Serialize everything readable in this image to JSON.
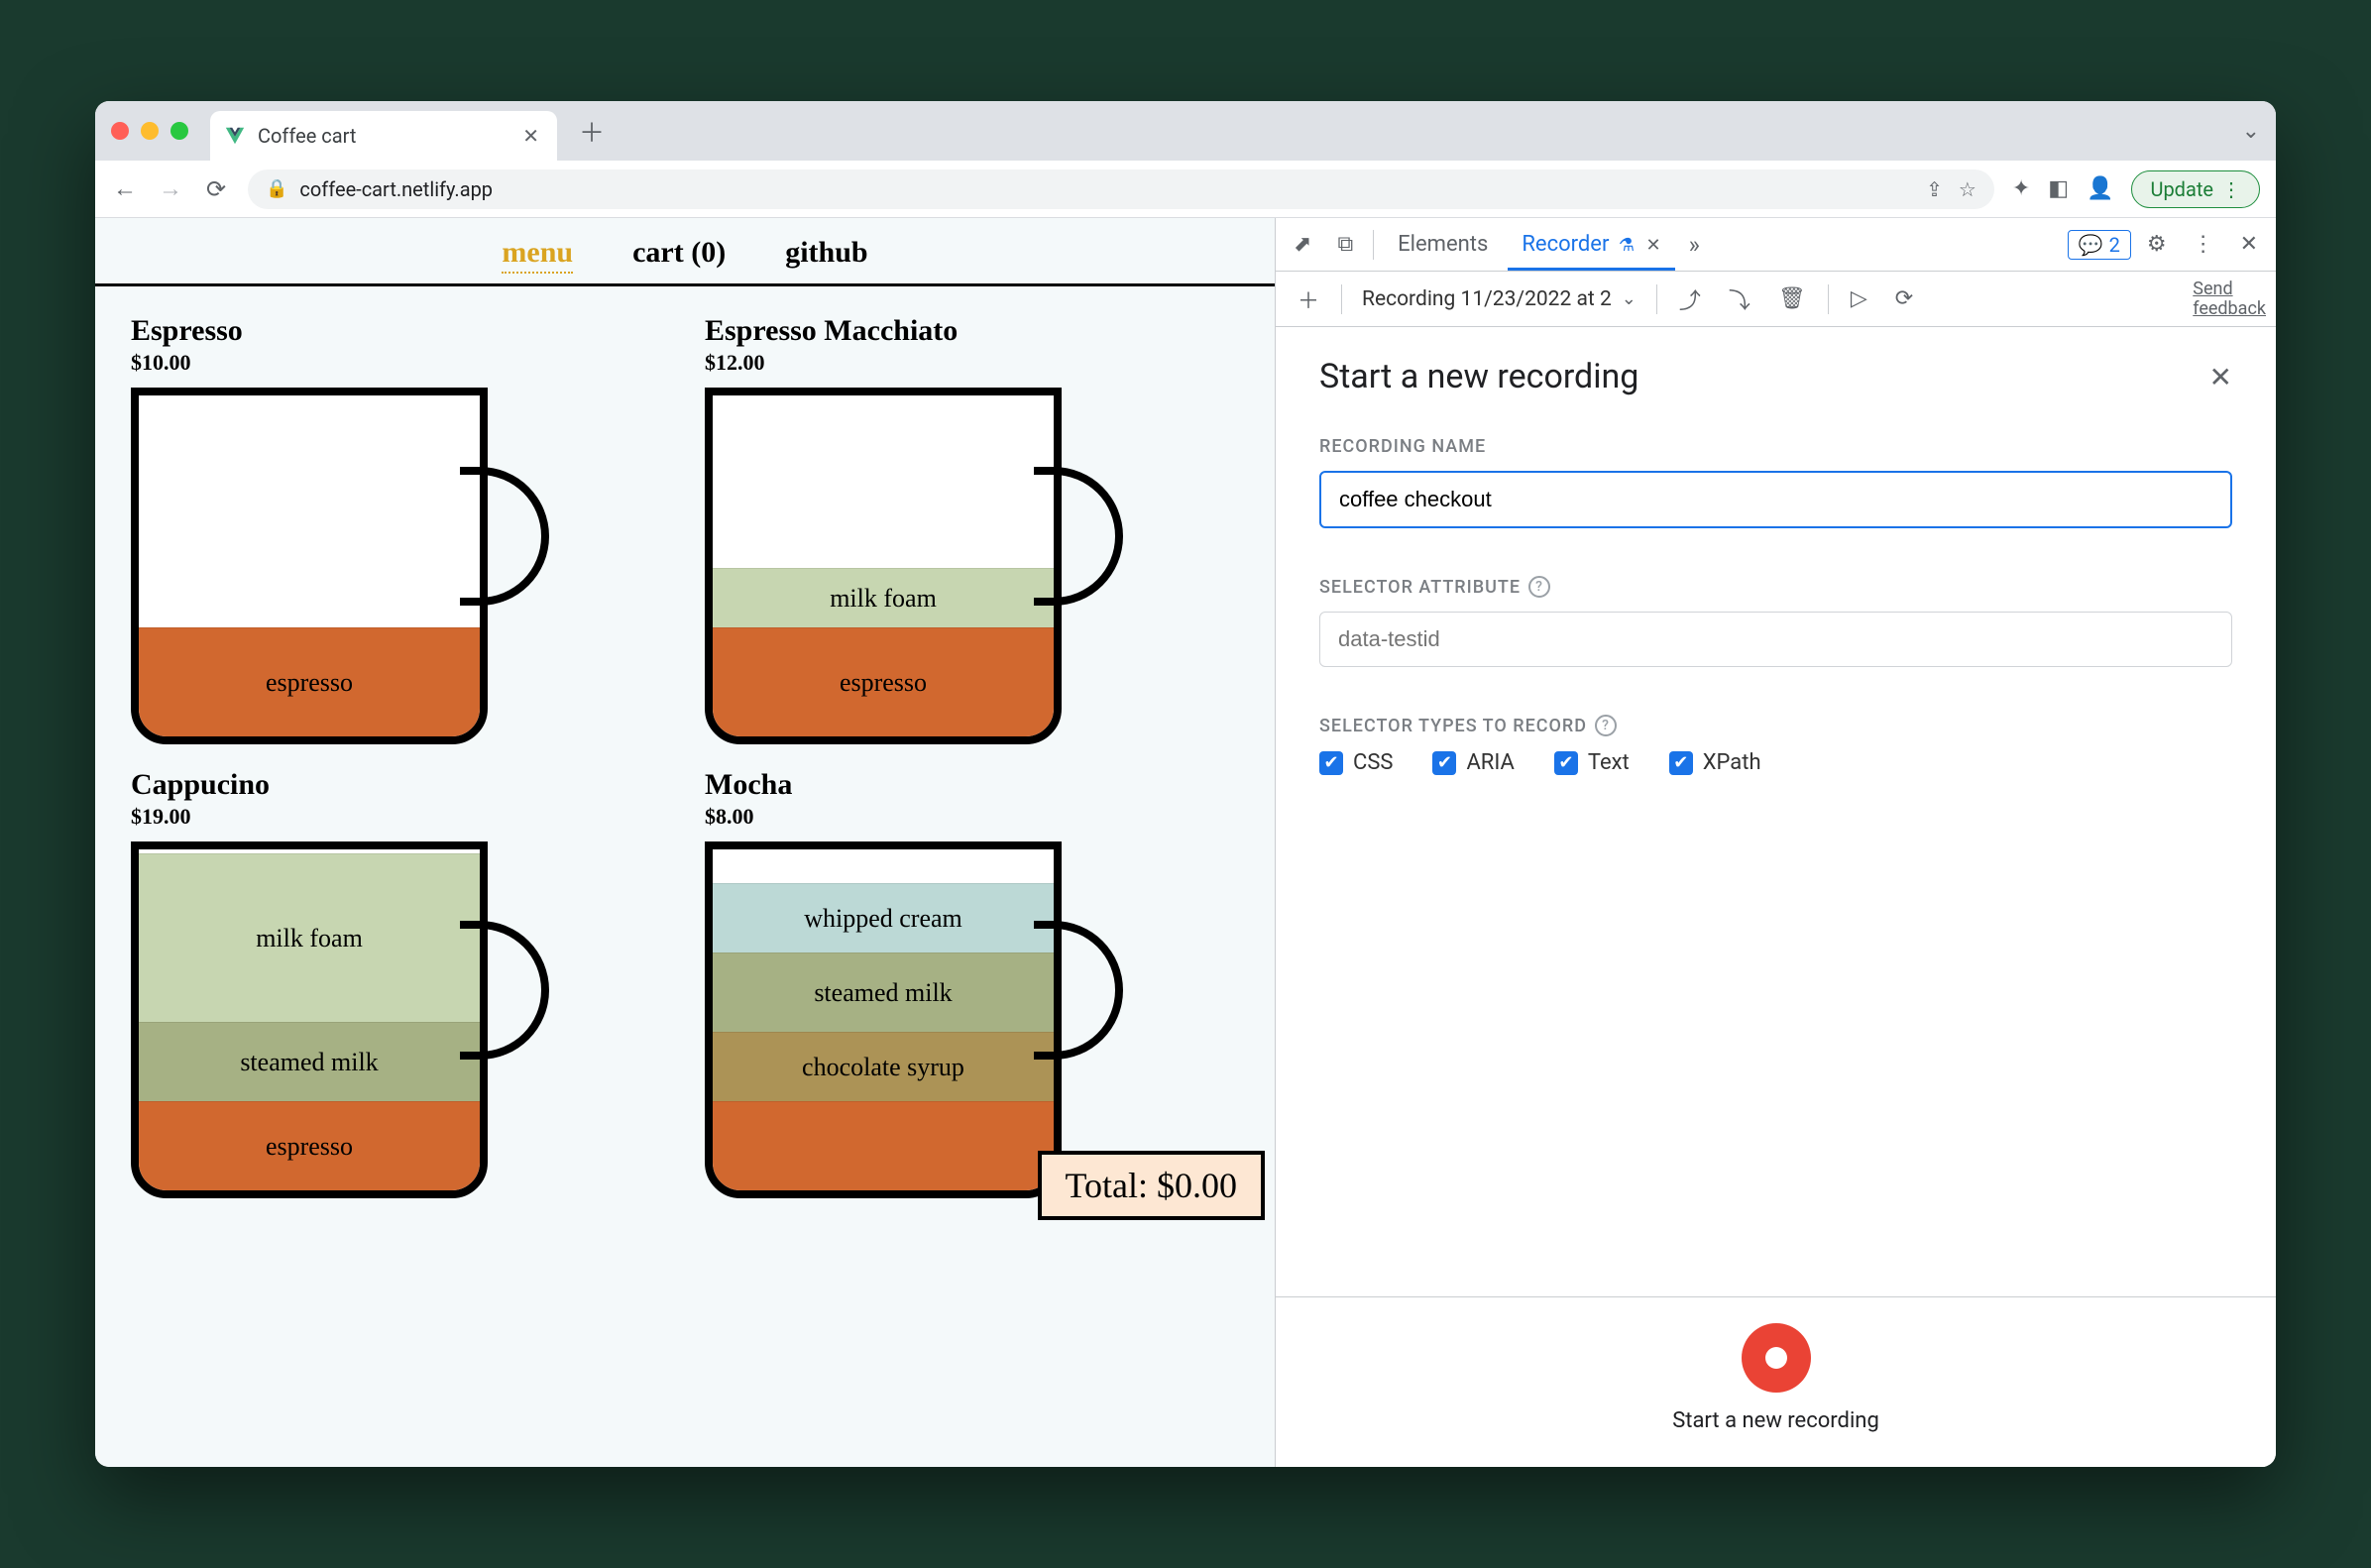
{
  "browser": {
    "tab_title": "Coffee cart",
    "url": "coffee-cart.netlify.app",
    "update_label": "Update"
  },
  "page": {
    "nav": {
      "menu": "menu",
      "cart": "cart (0)",
      "github": "github"
    },
    "products": [
      {
        "name": "Espresso",
        "price": "$10.00",
        "layers": [
          {
            "label": "espresso",
            "cls": "c-espresso",
            "h": 110
          }
        ]
      },
      {
        "name": "Espresso Macchiato",
        "price": "$12.00",
        "layers": [
          {
            "label": "milk foam",
            "cls": "c-milkfoam",
            "h": 60
          },
          {
            "label": "espresso",
            "cls": "c-espresso",
            "h": 110
          }
        ]
      },
      {
        "name": "Cappucino",
        "price": "$19.00",
        "layers": [
          {
            "label": "milk foam",
            "cls": "c-milkfoam",
            "h": 170
          },
          {
            "label": "steamed milk",
            "cls": "c-steamed",
            "h": 80
          },
          {
            "label": "espresso",
            "cls": "c-espresso",
            "h": 90
          }
        ]
      },
      {
        "name": "Mocha",
        "price": "$8.00",
        "layers": [
          {
            "label": "whipped cream",
            "cls": "c-whipped",
            "h": 70
          },
          {
            "label": "steamed milk",
            "cls": "c-steamed",
            "h": 80
          },
          {
            "label": "chocolate syrup",
            "cls": "c-chocsyrup",
            "h": 70
          },
          {
            "label": "",
            "cls": "c-espresso",
            "h": 90
          }
        ]
      }
    ],
    "total_label": "Total: $0.00"
  },
  "devtools": {
    "tabs": {
      "elements": "Elements",
      "recorder": "Recorder"
    },
    "issues_count": "2",
    "toolbar": {
      "recording_name": "Recording 11/23/2022 at 2",
      "send_feedback": "Send feedback"
    },
    "panel": {
      "heading": "Start a new recording",
      "recording_name_label": "RECORDING NAME",
      "recording_name_value": "coffee checkout",
      "selector_attribute_label": "SELECTOR ATTRIBUTE",
      "selector_attribute_placeholder": "data-testid",
      "selector_types_label": "SELECTOR TYPES TO RECORD",
      "types": {
        "css": "CSS",
        "aria": "ARIA",
        "text": "Text",
        "xpath": "XPath"
      },
      "footer_caption": "Start a new recording"
    }
  }
}
